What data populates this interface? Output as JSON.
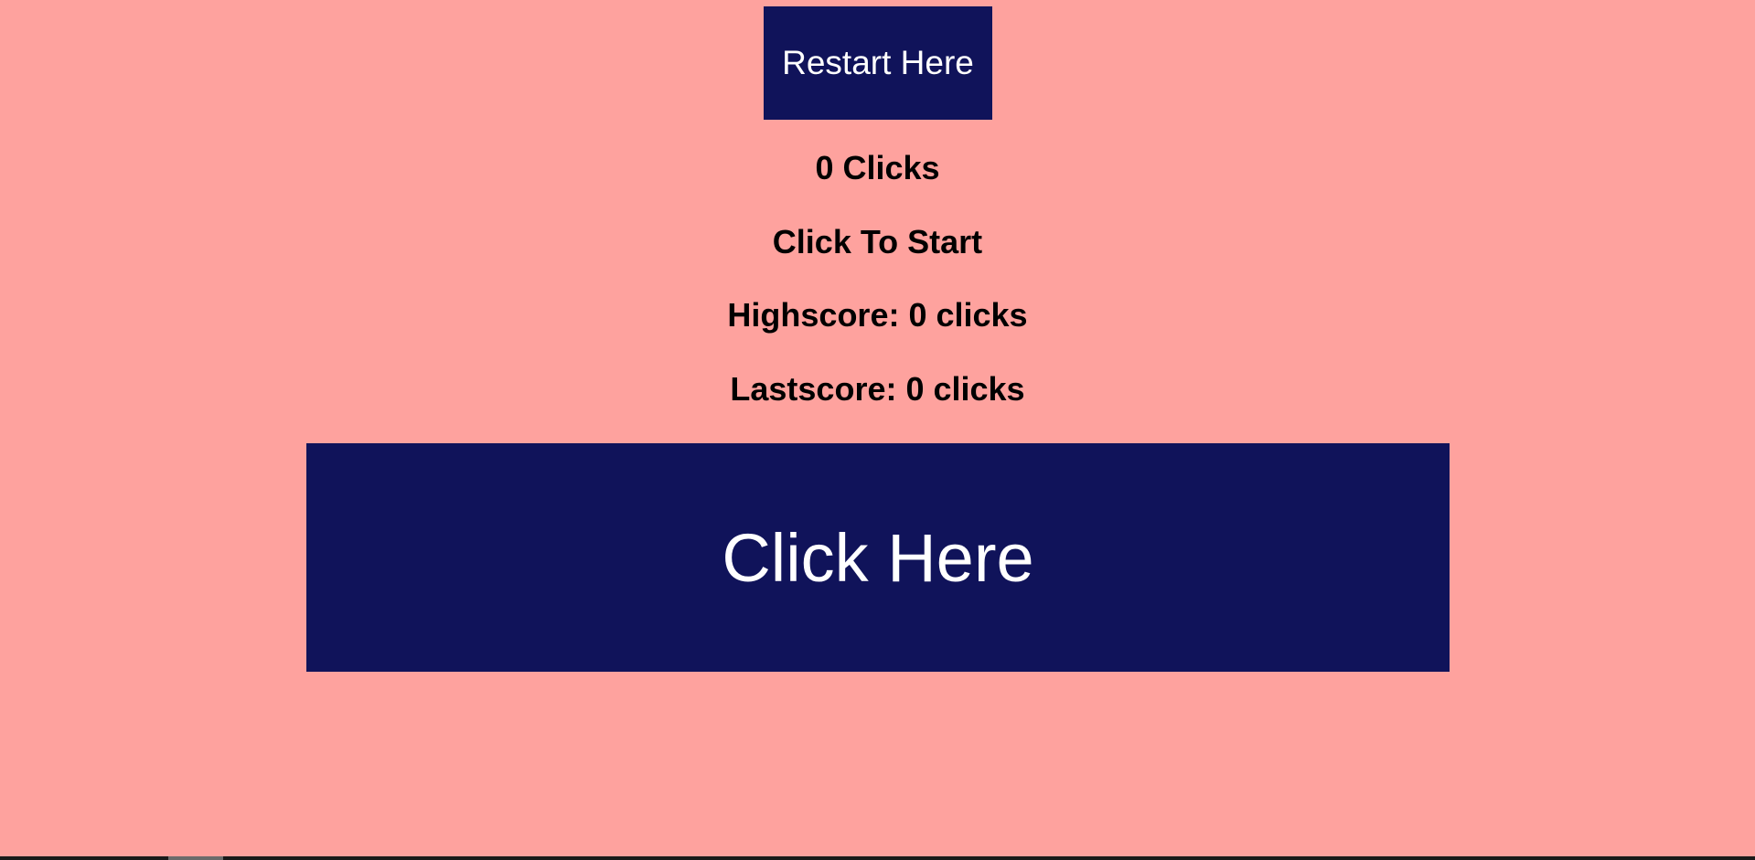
{
  "game": {
    "restart_label": "Restart Here",
    "clicks_text": "0 Clicks",
    "status_text": "Click To Start",
    "highscore_text": "Highscore: 0 clicks",
    "lastscore_text": "Lastscore: 0 clicks",
    "click_label": "Click Here"
  },
  "colors": {
    "background": "#fea29e",
    "button": "#10135a",
    "button_text": "#ffffff",
    "text": "#000000"
  }
}
